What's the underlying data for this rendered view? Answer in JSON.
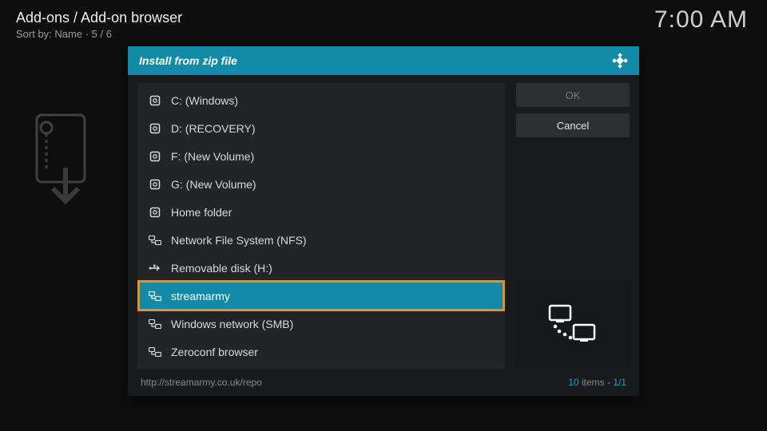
{
  "header": {
    "breadcrumb": "Add-ons / Add-on browser",
    "sort_line": "Sort by: Name  · 5 / 6",
    "clock": "7:00 AM"
  },
  "dialog": {
    "title": "Install from zip file",
    "buttons": {
      "ok": "OK",
      "cancel": "Cancel"
    },
    "footer": {
      "path": "http://streamarmy.co.uk/repo",
      "count_num": "10",
      "count_items_word": " items - ",
      "count_page": "1/1"
    }
  },
  "items": [
    {
      "label": "C: (Windows)",
      "icon": "drive"
    },
    {
      "label": "D: (RECOVERY)",
      "icon": "drive"
    },
    {
      "label": "F: (New Volume)",
      "icon": "drive"
    },
    {
      "label": "G: (New Volume)",
      "icon": "drive"
    },
    {
      "label": "Home folder",
      "icon": "drive"
    },
    {
      "label": "Network File System (NFS)",
      "icon": "network"
    },
    {
      "label": "Removable disk (H:)",
      "icon": "usb"
    },
    {
      "label": "streamarmy",
      "icon": "network",
      "selected": true
    },
    {
      "label": "Windows network (SMB)",
      "icon": "network"
    },
    {
      "label": "Zeroconf browser",
      "icon": "network"
    }
  ]
}
